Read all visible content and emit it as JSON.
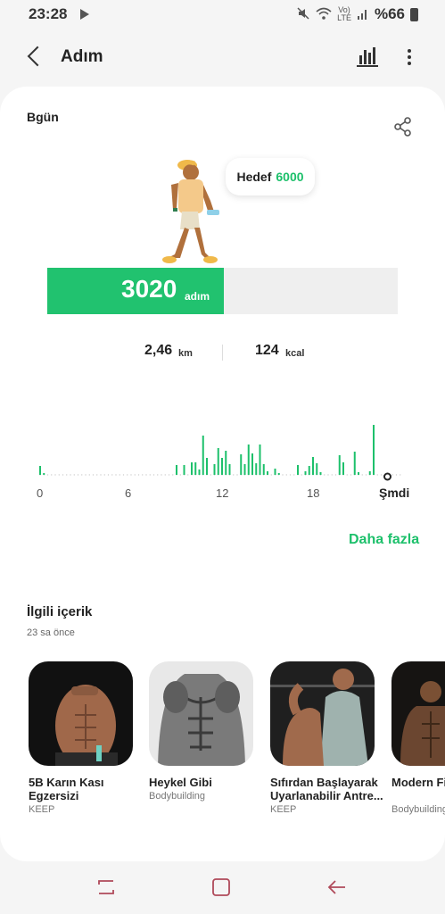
{
  "status_bar": {
    "time": "23:28",
    "network": "LTE",
    "volte": "Vo)",
    "battery_pct": "%66"
  },
  "app_bar": {
    "title": "Adım",
    "icons": [
      "back-icon",
      "bar-chart-icon",
      "more-vertical-icon"
    ]
  },
  "today": {
    "label": "Bgün",
    "goal_label": "Hedef",
    "goal_value": "6000",
    "steps_value": "3020",
    "steps_unit": "adım",
    "progress_fraction": 0.503,
    "distance_value": "2,46",
    "distance_unit": "km",
    "calories_value": "124",
    "calories_unit": "kcal"
  },
  "chart_data": {
    "type": "bar",
    "x_ticks": [
      "0",
      "6",
      "12",
      "18"
    ],
    "now_label": "Şmdi",
    "hour_range": [
      0,
      23.5
    ],
    "values": [
      10,
      2,
      0,
      0,
      0,
      0,
      0,
      0,
      0,
      0,
      0,
      0,
      0,
      0,
      0,
      0,
      0,
      0,
      0,
      0,
      0,
      0,
      0,
      0,
      0,
      0,
      0,
      0,
      0,
      0,
      0,
      0,
      0,
      0,
      0,
      0,
      11,
      0,
      11,
      0,
      14,
      14,
      6,
      44,
      19,
      0,
      12,
      30,
      19,
      27,
      12,
      0,
      0,
      23,
      12,
      34,
      24,
      13,
      34,
      12,
      4,
      0,
      7,
      2,
      0,
      0,
      0,
      0,
      11,
      0,
      4,
      10,
      20,
      13,
      3,
      0,
      0,
      0,
      0,
      22,
      14,
      0,
      0,
      26,
      3,
      0,
      0,
      4,
      56
    ]
  },
  "more_link": "Daha fazla",
  "related": {
    "title": "İlgili içerik",
    "time": "23 sa önce",
    "items": [
      {
        "title_line1": "5B Karın Kası",
        "title_line2": "Egzersizi",
        "source": "KEEP"
      },
      {
        "title_line1": "Heykel Gibi",
        "title_line2": "",
        "source": "Bodybuilding"
      },
      {
        "title_line1": "Sıfırdan Başlayarak",
        "title_line2": "Uyarlanabilir Antre...",
        "source": "KEEP"
      },
      {
        "title_line1": "Modern Fiz",
        "title_line2": "",
        "source": "Bodybuilding"
      }
    ]
  },
  "colors": {
    "accent": "#1dc06b",
    "progress_fill": "#21c26f",
    "background": "#f5f5f5"
  },
  "nav_bar": {
    "icons": [
      "recents-icon",
      "home-icon",
      "back-nav-icon"
    ]
  }
}
